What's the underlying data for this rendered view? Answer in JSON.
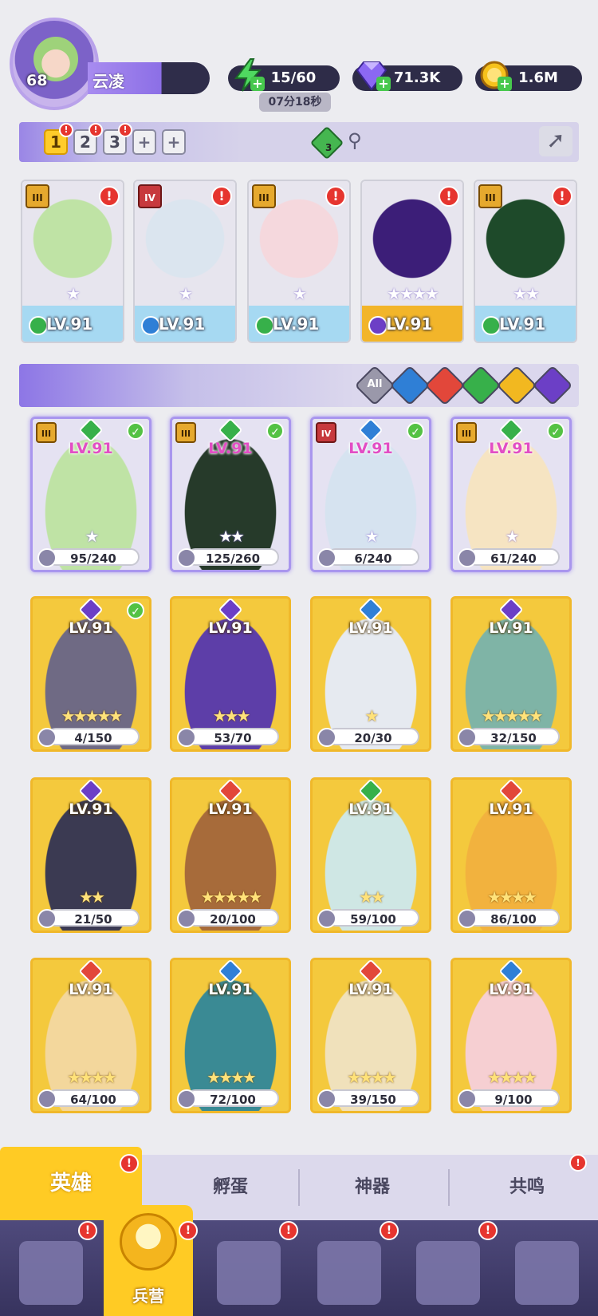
{
  "player": {
    "level": "68",
    "name": "云凌"
  },
  "resources": {
    "energy": "15/60",
    "energy_timer": "07分18秒",
    "gems": "71.3K",
    "coins": "1.6M"
  },
  "team_slots": [
    "1",
    "2",
    "3",
    "+",
    "+"
  ],
  "team_gem_count": "3",
  "team": [
    {
      "tier": "III",
      "tier_color": "gold",
      "element": "nature",
      "level": "LV.91",
      "stars": "★",
      "bg": "#bfe3a5",
      "foot": "#a6d9f2"
    },
    {
      "tier": "IV",
      "tier_color": "red",
      "element": "water",
      "level": "LV.91",
      "stars": "★",
      "bg": "#dbe5ef",
      "foot": "#a6d9f2"
    },
    {
      "tier": "III",
      "tier_color": "gold",
      "element": "nature",
      "level": "LV.91",
      "stars": "★",
      "bg": "#f5d8dd",
      "foot": "#a6d9f2"
    },
    {
      "tier": "",
      "tier_color": "",
      "element": "dark",
      "level": "LV.91",
      "stars": "★★★★",
      "bg": "#3c1e78",
      "foot": "#f2b52a"
    },
    {
      "tier": "III",
      "tier_color": "gold",
      "element": "nature",
      "level": "LV.91",
      "stars": "★★",
      "bg": "#1e4a2a",
      "foot": "#a6d9f2"
    }
  ],
  "filters": {
    "all_label": "All",
    "items": [
      "all",
      "water",
      "fire",
      "nature",
      "light",
      "dark"
    ]
  },
  "heroes": [
    {
      "level": "LV.91",
      "shards": "95/240",
      "stars": "★",
      "owned": true,
      "tier": "III",
      "check": true,
      "element": "nature",
      "bg": "#bfe3a5"
    },
    {
      "level": "LV.91",
      "shards": "125/260",
      "stars": "★★",
      "owned": true,
      "tier": "III",
      "check": true,
      "element": "nature",
      "bg": "#263a2a"
    },
    {
      "level": "LV.91",
      "shards": "6/240",
      "stars": "★",
      "owned": true,
      "tier": "IV",
      "check": true,
      "element": "water",
      "bg": "#d6e3f0"
    },
    {
      "level": "LV.91",
      "shards": "61/240",
      "stars": "★",
      "owned": true,
      "tier": "III",
      "check": true,
      "element": "nature",
      "bg": "#f6e4c2"
    },
    {
      "level": "LV.91",
      "shards": "4/150",
      "stars": "★★★★★",
      "owned": false,
      "tier": "",
      "check": true,
      "element": "dark",
      "bg": "#6f6a84"
    },
    {
      "level": "LV.91",
      "shards": "53/70",
      "stars": "★★★",
      "owned": false,
      "tier": "",
      "check": false,
      "element": "dark",
      "bg": "#5d3ea8"
    },
    {
      "level": "LV.91",
      "shards": "20/30",
      "stars": "★",
      "owned": false,
      "tier": "",
      "check": false,
      "element": "water",
      "bg": "#e6eaf0"
    },
    {
      "level": "LV.91",
      "shards": "32/150",
      "stars": "★★★★★",
      "owned": false,
      "tier": "",
      "check": false,
      "element": "dark",
      "bg": "#7fb4a6"
    },
    {
      "level": "LV.91",
      "shards": "21/50",
      "stars": "★★",
      "owned": false,
      "tier": "",
      "check": false,
      "element": "dark",
      "bg": "#3b3a52"
    },
    {
      "level": "LV.91",
      "shards": "20/100",
      "stars": "★★★★★",
      "owned": false,
      "tier": "",
      "check": false,
      "element": "fire",
      "bg": "#a76b3a"
    },
    {
      "level": "LV.91",
      "shards": "59/100",
      "stars": "★★",
      "owned": false,
      "tier": "",
      "check": false,
      "element": "nature",
      "bg": "#cfe7e4"
    },
    {
      "level": "LV.91",
      "shards": "86/100",
      "stars": "★★★★",
      "owned": false,
      "tier": "",
      "check": false,
      "element": "fire",
      "bg": "#f2b23e"
    },
    {
      "level": "LV.91",
      "shards": "64/100",
      "stars": "★★★★",
      "owned": false,
      "tier": "",
      "check": false,
      "element": "fire",
      "bg": "#f3d79c"
    },
    {
      "level": "LV.91",
      "shards": "72/100",
      "stars": "★★★★",
      "owned": false,
      "tier": "",
      "check": false,
      "element": "water",
      "bg": "#3a8a94"
    },
    {
      "level": "LV.91",
      "shards": "39/150",
      "stars": "★★★★",
      "owned": false,
      "tier": "",
      "check": false,
      "element": "fire",
      "bg": "#f0e1bb"
    },
    {
      "level": "LV.91",
      "shards": "9/100",
      "stars": "★★★★",
      "owned": false,
      "tier": "",
      "check": false,
      "element": "water",
      "bg": "#f6cfd2"
    }
  ],
  "tabs": {
    "heroes": "英雄",
    "eggs": "孵蛋",
    "artifacts": "神器",
    "resonance": "共鸣"
  },
  "nav": {
    "barracks": "兵营",
    "items": [
      "cards",
      "barracks",
      "map",
      "shrine",
      "mystic",
      "guild"
    ]
  },
  "colors": {
    "nature": "#37b04a",
    "water": "#2f7fd6",
    "fire": "#e2473a",
    "light": "#f2b820",
    "dark": "#6c3fc6",
    "all": "#9a98aa"
  }
}
